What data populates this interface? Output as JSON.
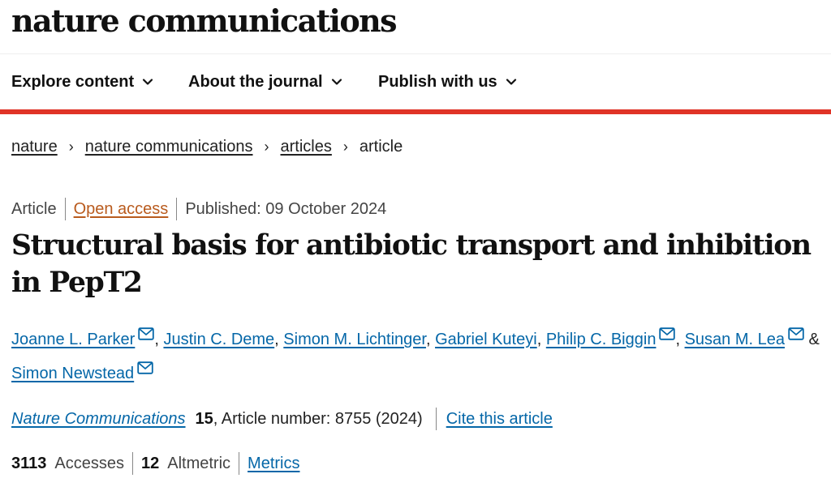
{
  "site": {
    "logo": "nature communications"
  },
  "nav": {
    "items": [
      {
        "label": "Explore content"
      },
      {
        "label": "About the journal"
      },
      {
        "label": "Publish with us"
      }
    ]
  },
  "breadcrumb": {
    "items": [
      "nature",
      "nature communications",
      "articles"
    ],
    "current": "article",
    "separator": "›"
  },
  "meta": {
    "type": "Article",
    "access": "Open access",
    "published": "Published: 09 October 2024"
  },
  "article": {
    "title": "Structural basis for antibiotic transport and inhibition in PepT2"
  },
  "authors": {
    "list": [
      "Joanne L. Parker",
      "Justin C. Deme",
      "Simon M. Lichtinger",
      "Gabriel Kuteyi",
      "Philip C. Biggin",
      "Susan M. Lea",
      "Simon Newstead"
    ],
    "comma": ", ",
    "amp": " & ",
    "icon": "mail-icon"
  },
  "citation": {
    "journal": "Nature Communications",
    "volume": "15",
    "details": ", Article number: 8755 (2024)",
    "cite_label": "Cite this article"
  },
  "metrics": {
    "accesses_count": "3113",
    "accesses_label": "Accesses",
    "altmetric_count": "12",
    "altmetric_label": "Altmetric",
    "metrics_label": "Metrics"
  },
  "colors": {
    "accent_bar": "#e03427",
    "link": "#0567a8",
    "open_access": "#b95b1e"
  }
}
